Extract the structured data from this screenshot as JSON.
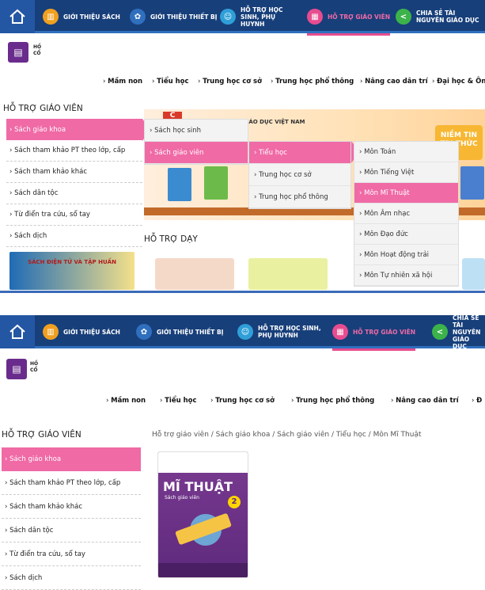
{
  "panel1": {
    "nav": {
      "items": [
        {
          "label": "GIỚI THIỆU SÁCH",
          "icon": "books-icon",
          "color": "#f0a020"
        },
        {
          "label": "GIỚI THIỆU THIẾT BỊ",
          "icon": "devices-icon",
          "color": "#2f6fbe"
        },
        {
          "label": "HỖ TRỢ HỌC SINH, PHỤ HUYNH",
          "icon": "family-icon",
          "color": "#2f9fd8"
        },
        {
          "label": "HỖ TRỢ GIÁO VIÊN",
          "icon": "teacher-icon",
          "color": "#e84c90"
        },
        {
          "label": "CHIA SẺ TÀI NGUYÊN GIÁO DỤC",
          "icon": "share-icon",
          "color": "#3cb34a"
        }
      ]
    },
    "levels": [
      "Mầm non",
      "Tiểu học",
      "Trung học cơ sở",
      "Trung học phổ thông",
      "Nâng cao dân trí",
      "Đại học & Ôn"
    ],
    "left_title": "HỖ TRỢ GIÁO VIÊN",
    "left_menu": [
      "Sách giáo khoa",
      "Sách tham khảo PT theo lớp, cấp",
      "Sách tham khảo khác",
      "Sách dân tộc",
      "Từ điển tra cứu, sổ tay",
      "Sách dịch"
    ],
    "flyout1": [
      "Sách học sinh",
      "Sách giáo viên"
    ],
    "flyout2": [
      "Tiểu học",
      "Trung học cơ sở",
      "Trung học phổ thông"
    ],
    "flyout3": [
      "Môn Toán",
      "Môn Tiếng Việt",
      "Môn Mĩ Thuật",
      "Môn Âm nhạc",
      "Môn Đạo đức",
      "Môn Hoạt động trải",
      "Môn Tự nhiên xã hội"
    ],
    "banner_heading": "GIÁO DỤC VIỆT NAM",
    "banner_badge": "NIỀM TIN TRI THỨC",
    "ad_text": "SÁCH ĐIỆN TỬ VÀ TẬP HUẤN",
    "section_title": "HỖ TRỢ DẠY"
  },
  "panel2": {
    "breadcrumb": "Hỗ trợ giáo viên / Sách giáo khoa / Sách giáo viên / Tiểu học / Môn Mĩ Thuật",
    "book": {
      "title": "MĨ THUẬT",
      "subtitle": "Sách giáo viên",
      "grade": "2"
    }
  },
  "colors": {
    "nav_bg": "#173f7a",
    "accent_pink": "#f06aa6"
  }
}
